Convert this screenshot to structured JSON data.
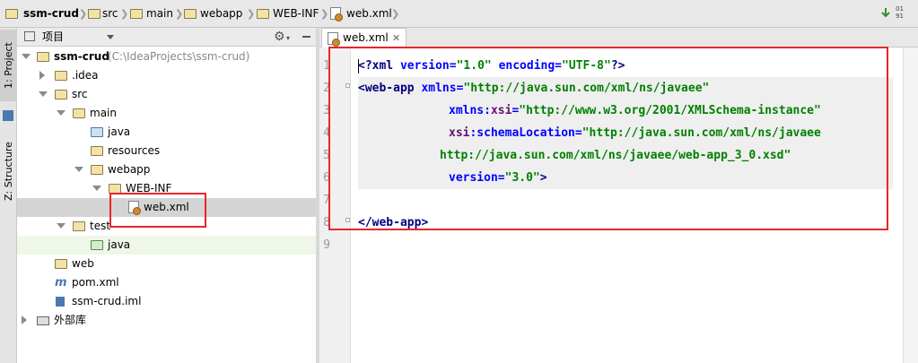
{
  "breadcrumb": {
    "items": [
      {
        "label": "ssm-crud",
        "icon": "folder-icon",
        "bold": true
      },
      {
        "label": "src",
        "icon": "folder-icon"
      },
      {
        "label": "main",
        "icon": "folder-icon"
      },
      {
        "label": "webapp",
        "icon": "folder-icon"
      },
      {
        "label": "WEB-INF",
        "icon": "folder-icon"
      },
      {
        "label": "web.xml",
        "icon": "xml-file-icon"
      }
    ]
  },
  "toolwindow": {
    "project_tab": "1: Project",
    "structure_tab": "Z: Structure",
    "panel_title": "项目"
  },
  "tree": {
    "root": {
      "label": "ssm-crud",
      "path": "(C:\\IdeaProjects\\ssm-crud)"
    },
    "items": [
      {
        "label": ".idea"
      },
      {
        "label": "src"
      },
      {
        "label": "main"
      },
      {
        "label": "java"
      },
      {
        "label": "resources"
      },
      {
        "label": "webapp"
      },
      {
        "label": "WEB-INF"
      },
      {
        "label": "web.xml"
      },
      {
        "label": "test"
      },
      {
        "label": "java"
      },
      {
        "label": "web"
      },
      {
        "label": "pom.xml"
      },
      {
        "label": "ssm-crud.iml"
      },
      {
        "label": "外部库"
      }
    ]
  },
  "editor": {
    "tab_label": "web.xml",
    "line_numbers": [
      "1",
      "2",
      "3",
      "4",
      "5",
      "6",
      "7",
      "8",
      "9"
    ],
    "lines": [
      {
        "a": "<?xml ",
        "b": "version=",
        "c": "\"1.0\" ",
        "d": "encoding=",
        "e": "\"UTF-8\"",
        "f": "?>"
      },
      {
        "a": "<web-app ",
        "b": "xmlns=",
        "c": "\"http://java.sun.com/xml/ns/javaee\""
      },
      {
        "a": "xmlns:",
        "b": "xsi",
        "c": "=",
        "d": "\"http://www.w3.org/2001/XMLSchema-instance\""
      },
      {
        "a": "xsi",
        "b": ":schemaLocation=",
        "c": "\"http://java.sun.com/xml/ns/javaee"
      },
      {
        "a": "http://java.sun.com/xml/ns/javaee/web-app_3_0.xsd\""
      },
      {
        "a": "version=",
        "b": "\"3.0\"",
        "c": ">"
      },
      {
        "a": ""
      },
      {
        "a": "</web-app>"
      },
      {
        "a": ""
      }
    ]
  },
  "colors": {
    "annotation_red": "#e8262a",
    "tag": "#000080",
    "attribute": "#0000ff",
    "value": "#008000"
  }
}
